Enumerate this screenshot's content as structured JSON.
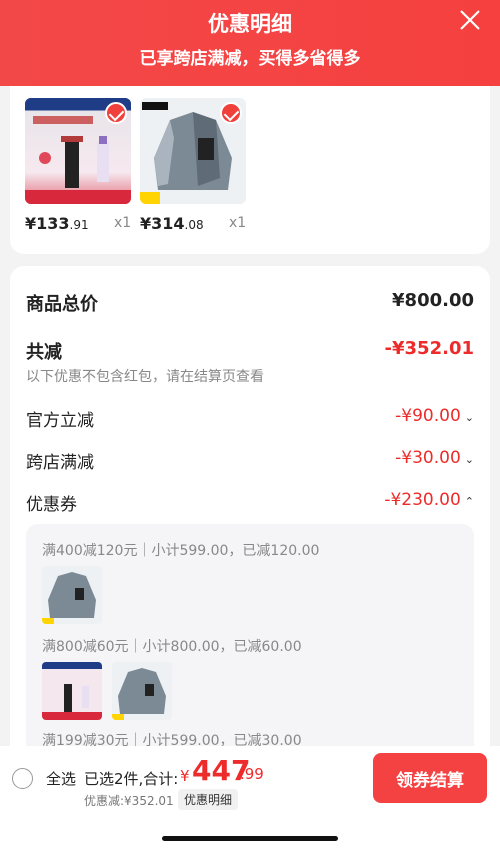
{
  "header": {
    "title": "优惠明细",
    "subtitle": "已享跨店满减，买得多省得多"
  },
  "products": [
    {
      "price_int": "¥133",
      "price_dec": ".91",
      "qty": "x1",
      "image": "cosmetic-product"
    },
    {
      "price_int": "¥314",
      "price_dec": ".08",
      "qty": "x1",
      "image": "jacket-product"
    }
  ],
  "summary": {
    "total_label": "商品总价",
    "total_value": "¥800.00",
    "reduce_label": "共减",
    "reduce_value": "-¥352.01",
    "note": "以下优惠不包含红包，请在结算页查看",
    "items": [
      {
        "label": "官方立减",
        "value": "-¥90.00"
      },
      {
        "label": "跨店满减",
        "value": "-¥30.00"
      },
      {
        "label": "优惠券",
        "value": "-¥230.00"
      }
    ]
  },
  "coupons": [
    {
      "text": "满400减120元｜小计599.00，已减120.00"
    },
    {
      "text": "满800减60元｜小计800.00，已减60.00"
    },
    {
      "text": "满199减30元｜小计599.00，已减30.00"
    }
  ],
  "bottom": {
    "select_all": "全选",
    "selected": "已选2件,合计:",
    "currency": "¥",
    "total_int": "447",
    "total_dec": ".99",
    "discount": "优惠减:¥352.01",
    "detail_tag": "优惠明细",
    "checkout": "领券结算"
  },
  "colors": {
    "accent": "#ee2b2b",
    "header": "#f34848"
  }
}
